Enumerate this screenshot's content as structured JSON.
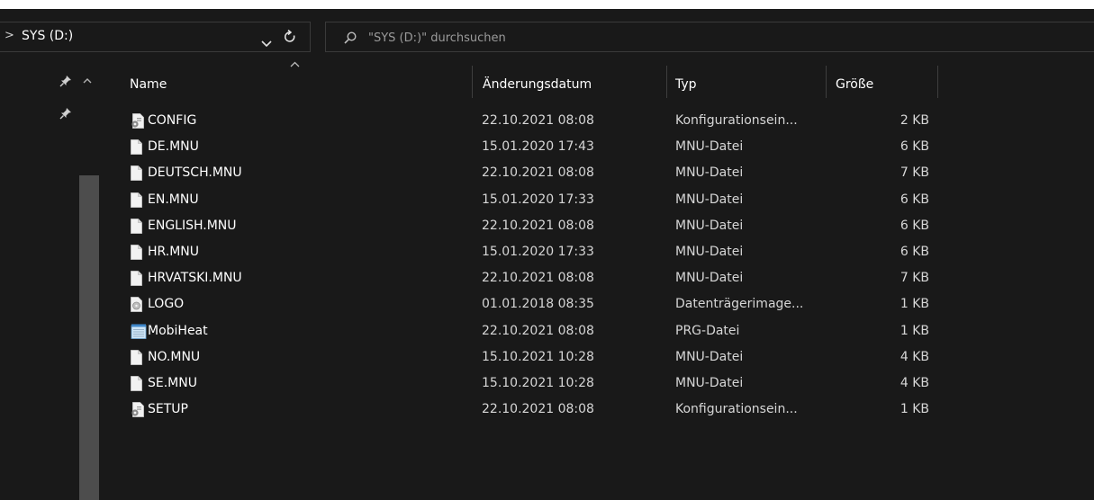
{
  "address": {
    "crumb_chevron": ">",
    "location": "SYS (D:)"
  },
  "search": {
    "placeholder": "\"SYS (D:)\" durchsuchen"
  },
  "columns": {
    "name": "Name",
    "date": "Änderungsdatum",
    "type": "Typ",
    "size": "Größe"
  },
  "files": [
    {
      "name": "CONFIG",
      "date": "22.10.2021 08:08",
      "type": "Konfigurationsein...",
      "size": "2 KB",
      "icon": "config-file-icon"
    },
    {
      "name": "DE.MNU",
      "date": "15.01.2020 17:43",
      "type": "MNU-Datei",
      "size": "6 KB",
      "icon": "blank-file-icon"
    },
    {
      "name": "DEUTSCH.MNU",
      "date": "22.10.2021 08:08",
      "type": "MNU-Datei",
      "size": "7 KB",
      "icon": "blank-file-icon"
    },
    {
      "name": "EN.MNU",
      "date": "15.01.2020 17:33",
      "type": "MNU-Datei",
      "size": "6 KB",
      "icon": "blank-file-icon"
    },
    {
      "name": "ENGLISH.MNU",
      "date": "22.10.2021 08:08",
      "type": "MNU-Datei",
      "size": "6 KB",
      "icon": "blank-file-icon"
    },
    {
      "name": "HR.MNU",
      "date": "15.01.2020 17:33",
      "type": "MNU-Datei",
      "size": "6 KB",
      "icon": "blank-file-icon"
    },
    {
      "name": "HRVATSKI.MNU",
      "date": "22.10.2021 08:08",
      "type": "MNU-Datei",
      "size": "7 KB",
      "icon": "blank-file-icon"
    },
    {
      "name": "LOGO",
      "date": "01.01.2018 08:35",
      "type": "Datenträgerimage...",
      "size": "1 KB",
      "icon": "disc-image-icon"
    },
    {
      "name": "MobiHeat",
      "date": "22.10.2021 08:08",
      "type": "PRG-Datei",
      "size": "1 KB",
      "icon": "notepad-file-icon"
    },
    {
      "name": "NO.MNU",
      "date": "15.10.2021 10:28",
      "type": "MNU-Datei",
      "size": "4 KB",
      "icon": "blank-file-icon"
    },
    {
      "name": "SE.MNU",
      "date": "15.10.2021 10:28",
      "type": "MNU-Datei",
      "size": "4 KB",
      "icon": "blank-file-icon"
    },
    {
      "name": "SETUP",
      "date": "22.10.2021 08:08",
      "type": "Konfigurationsein...",
      "size": "1 KB",
      "icon": "config-file-icon"
    }
  ]
}
